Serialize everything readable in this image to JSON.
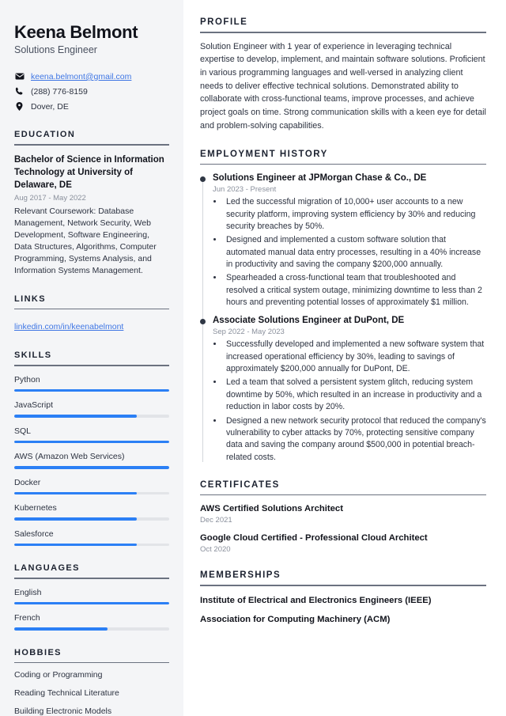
{
  "sidebar": {
    "name": "Keena Belmont",
    "job_title": "Solutions Engineer",
    "contacts": [
      {
        "icon": "envelope-icon",
        "text": "keena.belmont@gmail.com",
        "is_link": true
      },
      {
        "icon": "phone-icon",
        "text": "(288) 776-8159",
        "is_link": false
      },
      {
        "icon": "map-pin-icon",
        "text": "Dover, DE",
        "is_link": false
      }
    ],
    "education": {
      "heading": "EDUCATION",
      "degree": "Bachelor of Science in Information Technology at University of Delaware, DE",
      "date": "Aug 2017 - May 2022",
      "description": "Relevant Coursework: Database Management, Network Security, Web Development, Software Engineering, Data Structures, Algorithms, Computer Programming, Systems Analysis, and Information Systems Management."
    },
    "links": {
      "heading": "LINKS",
      "items": [
        {
          "label": "linkedin.com/in/keenabelmont"
        }
      ]
    },
    "skills": {
      "heading": "SKILLS",
      "items": [
        {
          "label": "Python",
          "level": 100
        },
        {
          "label": "JavaScript",
          "level": 79
        },
        {
          "label": "SQL",
          "level": 100
        },
        {
          "label": "AWS (Amazon Web Services)",
          "level": 100
        },
        {
          "label": "Docker",
          "level": 79
        },
        {
          "label": "Kubernetes",
          "level": 79
        },
        {
          "label": "Salesforce",
          "level": 79
        }
      ]
    },
    "languages": {
      "heading": "LANGUAGES",
      "items": [
        {
          "label": "English",
          "level": 100
        },
        {
          "label": "French",
          "level": 60
        }
      ]
    },
    "hobbies": {
      "heading": "HOBBIES",
      "items": [
        {
          "label": "Coding or Programming"
        },
        {
          "label": "Reading Technical Literature"
        },
        {
          "label": "Building Electronic Models"
        }
      ]
    }
  },
  "main": {
    "profile": {
      "heading": "PROFILE",
      "text": "Solution Engineer with 1 year of experience in leveraging technical expertise to develop, implement, and maintain software solutions. Proficient in various programming languages and well-versed in analyzing client needs to deliver effective technical solutions. Demonstrated ability to collaborate with cross-functional teams, improve processes, and achieve project goals on time. Strong communication skills with a keen eye for detail and problem-solving capabilities."
    },
    "employment": {
      "heading": "EMPLOYMENT HISTORY",
      "jobs": [
        {
          "title": "Solutions Engineer at JPMorgan Chase & Co., DE",
          "date": "Jun 2023 - Present",
          "bullets": [
            "Led the successful migration of 10,000+ user accounts to a new security platform, improving system efficiency by 30% and reducing security breaches by 50%.",
            "Designed and implemented a custom software solution that automated manual data entry processes, resulting in a 40% increase in productivity and saving the company $200,000 annually.",
            "Spearheaded a cross-functional team that troubleshooted and resolved a critical system outage, minimizing downtime to less than 2 hours and preventing potential losses of approximately $1 million."
          ]
        },
        {
          "title": "Associate Solutions Engineer at DuPont, DE",
          "date": "Sep 2022 - May 2023",
          "bullets": [
            "Successfully developed and implemented a new software system that increased operational efficiency by 30%, leading to savings of approximately $200,000 annually for DuPont, DE.",
            "Led a team that solved a persistent system glitch, reducing system downtime by 50%, which resulted in an increase in productivity and a reduction in labor costs by 20%.",
            "Designed a new network security protocol that reduced the company's vulnerability to cyber attacks by 70%, protecting sensitive company data and saving the company around $500,000 in potential breach-related costs."
          ]
        }
      ]
    },
    "certificates": {
      "heading": "CERTIFICATES",
      "items": [
        {
          "title": "AWS Certified Solutions Architect",
          "date": "Dec 2021"
        },
        {
          "title": "Google Cloud Certified - Professional Cloud Architect",
          "date": "Oct 2020"
        }
      ]
    },
    "memberships": {
      "heading": "MEMBERSHIPS",
      "items": [
        {
          "label": "Institute of Electrical and Electronics Engineers (IEEE)"
        },
        {
          "label": "Association for Computing Machinery (ACM)"
        }
      ]
    }
  },
  "colors": {
    "accent": "#2b7ff5",
    "link": "#3f76e4",
    "heading": "#1c2230",
    "sidebar_bg": "#f4f5f7"
  }
}
